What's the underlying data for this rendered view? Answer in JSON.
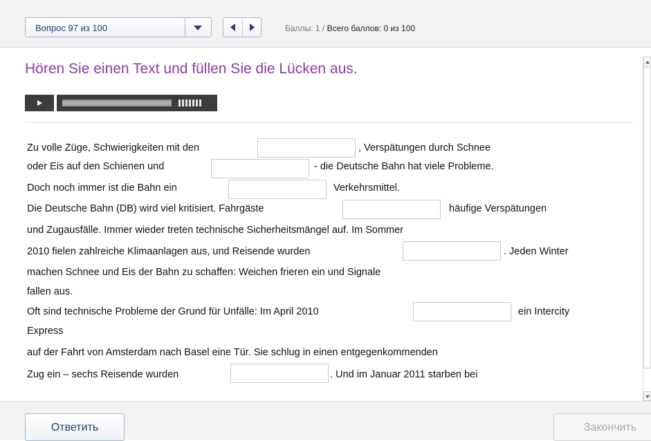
{
  "toolbar": {
    "question_select": "Вопрос 97 из 100",
    "score_label": "Баллы: 1",
    "score_separator": "/",
    "total_label": "Всего баллов: 0 из 100"
  },
  "task": {
    "title": "Hören Sie einen Text und füllen Sie die Lücken aus."
  },
  "player": {
    "progress": 0.7
  },
  "text_lines": [
    " Zu volle Züge, Schwierigkeiten mit den",
    ", Verspätungen durch Schnee",
    "oder Eis auf den Schienen und",
    "- die Deutsche Bahn hat viele Probleme.",
    "Doch noch immer ist die Bahn ein",
    "Verkehrsmittel.",
    "Die Deutsche Bahn (DB) wird viel kritisiert. Fahrgäste",
    "häufige Verspätungen",
    "und Zugausfälle. Immer wieder treten technische Sicherheitsmängel auf. Im Sommer",
    "2010 fielen zahlreiche Klimaanlagen aus, und Reisende wurden",
    ". Jeden Winter",
    "machen Schnee und Eis der Bahn zu schaffen: Weichen frieren ein und Signale",
    "fallen aus.",
    "Oft sind technische Probleme der Grund für Unfälle: Im April 2010",
    "ein Intercity",
    "Express",
    "auf der Fahrt von Amsterdam nach Basel eine Tür. Sie schlug in einen entgegenkommenden",
    "Zug ein – sechs Reisende wurden",
    ". Und im Januar 2011 starben bei"
  ],
  "gaps": [
    "",
    "",
    "",
    "",
    "",
    "",
    ""
  ],
  "buttons": {
    "answer": "Ответить",
    "finish": "Закончить"
  },
  "colors": {
    "title": "#8b3aa8",
    "link": "#1f3f7a"
  }
}
